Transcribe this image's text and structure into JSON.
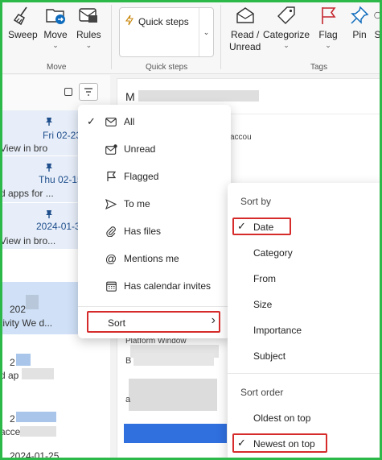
{
  "ribbon": {
    "move_group": {
      "label": "Move",
      "buttons": [
        {
          "label": "Sweep",
          "icon": "broom-icon"
        },
        {
          "label": "Move",
          "icon": "folder-move-icon"
        },
        {
          "label": "Rules",
          "icon": "rules-icon"
        }
      ]
    },
    "quick_steps_group": {
      "label": "Quick steps",
      "value": "Quick steps",
      "icon": "lightning-icon"
    },
    "tags_group": {
      "label": "Tags",
      "buttons": [
        {
          "label_line1": "Read /",
          "label_line2": "Unread",
          "icon": "envelope-open-icon"
        },
        {
          "label": "Categorize",
          "icon": "tag-icon"
        },
        {
          "label": "Flag",
          "icon": "flag-icon"
        },
        {
          "label": "Pin",
          "icon": "pin-icon"
        },
        {
          "label": "S",
          "icon": "snooze-icon"
        }
      ]
    }
  },
  "message_list": {
    "items": [
      {
        "date": "Fri 02-23",
        "snippet": "View in bro",
        "pinned": true
      },
      {
        "date": "Thu 02-15",
        "snippet": "d apps for ...",
        "pinned": true
      },
      {
        "date": "2024-01-31",
        "snippet": "View in bro...",
        "pinned": true
      },
      {
        "date": "202",
        "snippet": "tivity We d...",
        "pinned": false
      },
      {
        "date": "2",
        "snippet": "d ap",
        "pinned": false
      },
      {
        "date": "2",
        "snippet": "acce",
        "pinned": false
      },
      {
        "date": "2024-01-25",
        "snippet": "",
        "pinned": false
      }
    ]
  },
  "reading_pane": {
    "header_initial": "M",
    "snippet_1": "accou",
    "snippet_2": "Platform Window",
    "snippet_3": "B",
    "snippet_4": "a"
  },
  "filter_menu": {
    "items": [
      {
        "label": "All",
        "icon": "mail-icon",
        "checked": true
      },
      {
        "label": "Unread",
        "icon": "mail-unread-icon",
        "checked": false
      },
      {
        "label": "Flagged",
        "icon": "flag-icon",
        "checked": false
      },
      {
        "label": "To me",
        "icon": "send-icon",
        "checked": false
      },
      {
        "label": "Has files",
        "icon": "attachment-icon",
        "checked": false
      },
      {
        "label": "Mentions me",
        "icon": "mention-icon",
        "checked": false
      },
      {
        "label": "Has calendar invites",
        "icon": "calendar-icon",
        "checked": false
      }
    ],
    "sort_label": "Sort"
  },
  "sort_submenu": {
    "sort_by_heading": "Sort by",
    "sort_by_options": [
      "Date",
      "Category",
      "From",
      "Size",
      "Importance",
      "Subject"
    ],
    "selected_sort_by": "Date",
    "sort_order_heading": "Sort order",
    "sort_order_options": [
      "Oldest on top",
      "Newest on top"
    ],
    "selected_sort_order": "Newest on top"
  },
  "colors": {
    "accent": "#0f6cbd",
    "highlight_box": "#d62b2b",
    "frame": "#2db84a",
    "selected_row": "#cfe0f7",
    "pinned_row": "#e7eef9"
  }
}
